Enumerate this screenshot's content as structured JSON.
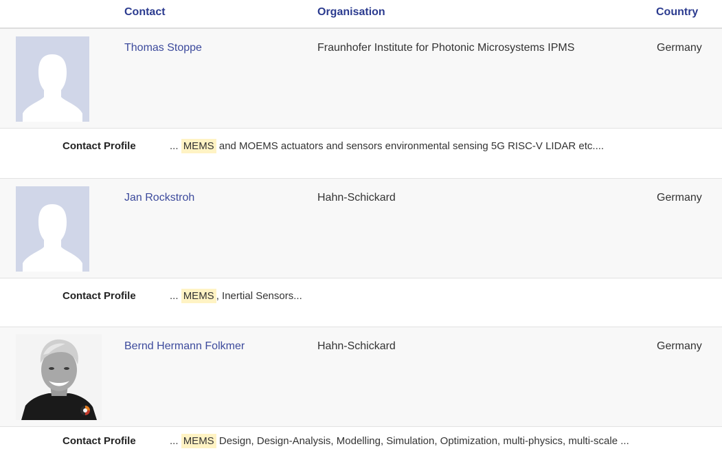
{
  "header": {
    "cut_letter": "S",
    "col_contact": "Contact",
    "col_organisation": "Organisation",
    "col_country": "Country"
  },
  "contacts": [
    {
      "name": "Thomas Stoppe",
      "organisation": "Fraunhofer Institute for Photonic Microsystems IPMS",
      "country": "Germany",
      "avatar": "default-avatar-icon",
      "profile_label": "Contact Profile",
      "profile_prefix": "...",
      "profile_highlight": "MEMS",
      "profile_rest": " and MOEMS actuators and sensors environmental sensing 5G RISC-V LIDAR etc...."
    },
    {
      "name": "Jan Rockstroh",
      "organisation": "Hahn-Schickard",
      "country": "Germany",
      "avatar": "default-avatar-icon",
      "profile_label": "Contact Profile",
      "profile_prefix": "...",
      "profile_highlight": "MEMS",
      "profile_rest": ", Inertial Sensors..."
    },
    {
      "name": "Bernd Hermann Folkmer",
      "organisation": "Hahn-Schickard",
      "country": "Germany",
      "avatar": "profile-photo",
      "profile_label": "Contact Profile",
      "profile_prefix": "...",
      "profile_highlight": "MEMS",
      "profile_rest": " Design, Design-Analysis, Modelling, Simulation, Optimization, multi-physics, multi-scale ..."
    }
  ],
  "colors": {
    "header_text": "#2b3b8f",
    "link": "#3c4a9c",
    "highlight": "#fff3c4",
    "avatar_bg": "#d0d6e8",
    "row_bg": "#f8f8f8"
  }
}
